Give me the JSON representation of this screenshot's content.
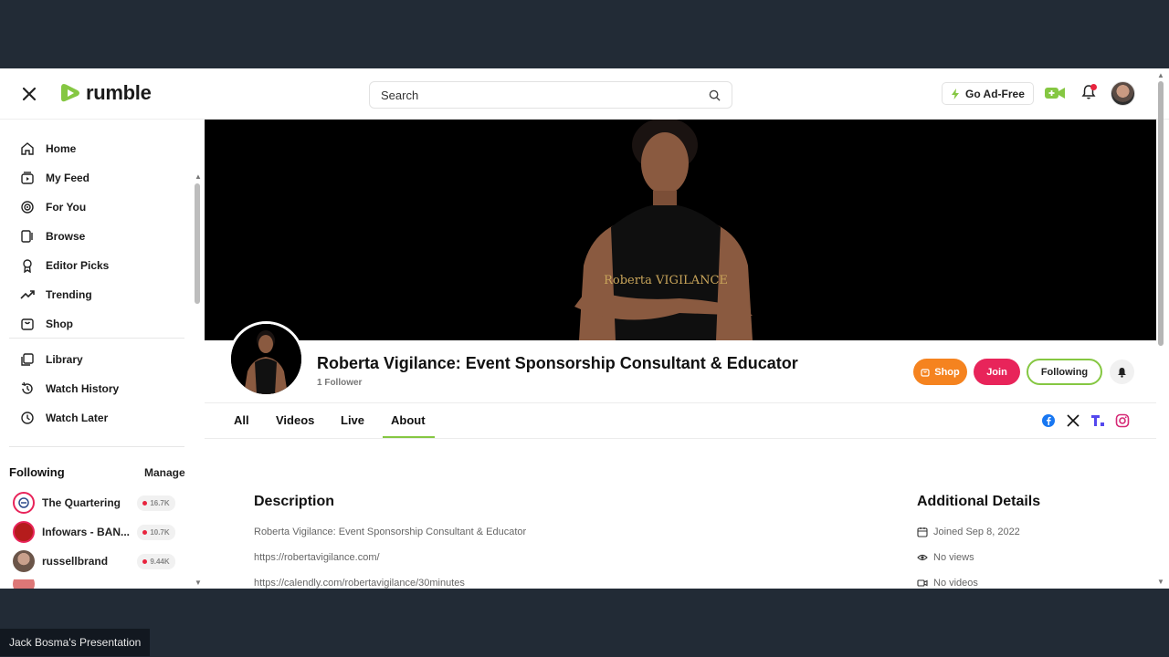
{
  "topbar": {
    "logo_text": "rumble",
    "search_placeholder": "Search",
    "ad_free_label": "Go Ad-Free"
  },
  "sidebar": {
    "items": [
      {
        "label": "Home",
        "icon": "home-icon"
      },
      {
        "label": "My Feed",
        "icon": "feed-icon"
      },
      {
        "label": "For You",
        "icon": "target-icon"
      },
      {
        "label": "Browse",
        "icon": "browse-icon"
      },
      {
        "label": "Editor Picks",
        "icon": "ribbon-icon"
      },
      {
        "label": "Trending",
        "icon": "trending-icon"
      },
      {
        "label": "Shop",
        "icon": "bag-icon"
      },
      {
        "label": "Library",
        "icon": "library-icon"
      },
      {
        "label": "Watch History",
        "icon": "history-icon"
      },
      {
        "label": "Watch Later",
        "icon": "clock-icon"
      }
    ],
    "following_title": "Following",
    "manage_label": "Manage",
    "following": [
      {
        "name": "The Quartering",
        "count": "16.7K"
      },
      {
        "name": "Infowars - BAN...",
        "count": "10.7K"
      },
      {
        "name": "russellbrand",
        "count": "9.44K"
      }
    ]
  },
  "channel": {
    "name": "Roberta Vigilance: Event Sponsorship Consultant & Educator",
    "followers": "1 Follower",
    "banner_text": "Roberta VIGILANCE",
    "shop_label": "Shop",
    "join_label": "Join",
    "following_label": "Following",
    "tabs": [
      "All",
      "Videos",
      "Live",
      "About"
    ],
    "active_tab": "About"
  },
  "about": {
    "description_title": "Description",
    "description_lines": [
      "Roberta Vigilance: Event Sponsorship Consultant & Educator",
      "https://robertavigilance.com/",
      "https://calendly.com/robertavigilance/30minutes"
    ],
    "details_title": "Additional Details",
    "details": [
      {
        "icon": "calendar-icon",
        "text": "Joined Sep 8, 2022"
      },
      {
        "icon": "eye-icon",
        "text": "No views"
      },
      {
        "icon": "video-icon",
        "text": "No videos"
      }
    ]
  },
  "presenter_label": "Jack Bosma's Presentation",
  "colors": {
    "brand_green": "#85c742",
    "shop_orange": "#f5831f",
    "join_red": "#e8245a"
  }
}
